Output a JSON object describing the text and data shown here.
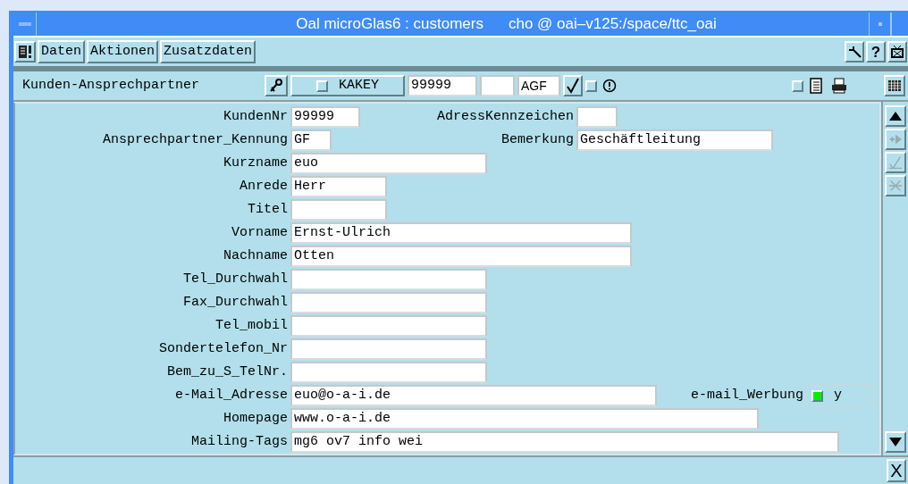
{
  "window": {
    "title": "Oal microGlas6 : customers",
    "subtitle": "cho @ oai–v125:/space/ttc_oai"
  },
  "menu": [
    {
      "label": "Daten"
    },
    {
      "label": "Aktionen"
    },
    {
      "label": "Zusatzdaten"
    }
  ],
  "help_button": "?",
  "toolbar": {
    "form_name": "Kunden-Ansprechpartner",
    "key_button": {
      "label": "KAKEY",
      "checked": false
    },
    "key_value": "99999",
    "code": "AGF",
    "confirm_checked": false,
    "print_checked": false
  },
  "rows": [
    {
      "label": "KundenNr",
      "value": "99999",
      "extra": {
        "kind": "field",
        "label": "AdressKennzeichen"
      }
    },
    {
      "label": "Ansprechpartner_Kennung",
      "value": "GF",
      "extra": {
        "kind": "field",
        "label": "Bemerkung",
        "value": "Geschäftleitung"
      }
    },
    {
      "label": "Kurzname",
      "value": "euo"
    },
    {
      "label": "Anrede",
      "value": "Herr"
    },
    {
      "label": "Titel"
    },
    {
      "label": "Vorname",
      "value": "Ernst-Ulrich"
    },
    {
      "label": "Nachname",
      "value": "Otten"
    },
    {
      "label": "Tel_Durchwahl"
    },
    {
      "label": "Fax_Durchwahl"
    },
    {
      "label": "Tel_mobil"
    },
    {
      "label": "Sondertelefon_Nr"
    },
    {
      "label": "Bem_zu_S_TelNr."
    },
    {
      "label": "e-Mail_Adresse",
      "value": "euo@o-a-i.de",
      "extra": {
        "kind": "checkbox",
        "label": "e-mail_Werbung",
        "checked": true,
        "value": "y"
      }
    },
    {
      "label": "Homepage",
      "value": "www.o-a-i.de"
    },
    {
      "label": "Mailing-Tags",
      "value": "mg6 ov7 info wei"
    }
  ],
  "side_buttons": [
    {
      "kind": "add",
      "disabled": true
    },
    {
      "kind": "check",
      "disabled": true
    },
    {
      "kind": "cut",
      "disabled": true
    }
  ],
  "close_button": "X"
}
